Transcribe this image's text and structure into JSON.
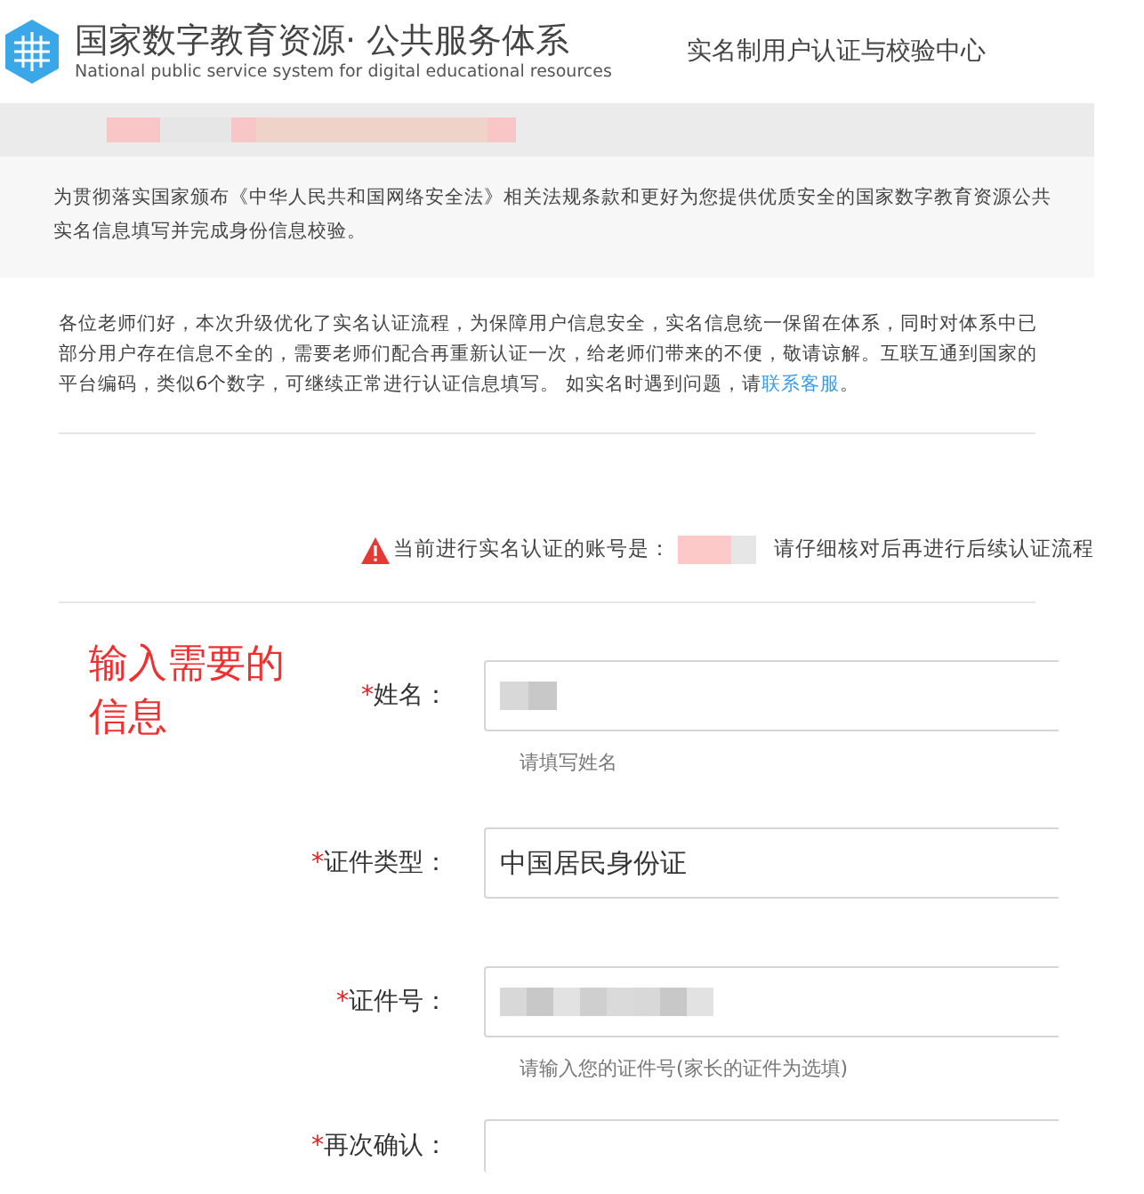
{
  "header": {
    "title": "国家数字教育资源· 公共服务体系",
    "subtitle": "National public service system for digital educational resources",
    "center_title": "实名制用户认证与校验中心"
  },
  "banner": {
    "redacted": true
  },
  "notice": {
    "lines": [
      "为贯彻落实国家颁布《中华人民共和国网络安全法》相关法规条款和更好为您提供优质安全的国家数字教育资源公共",
      "实名信息填写并完成身份信息校验。"
    ]
  },
  "intro": {
    "lines": [
      "各位老师们好，本次升级优化了实名认证流程，为保障用户信息安全，实名信息统一保留在体系，同时对体系中已",
      "部分用户存在信息不全的，需要老师们配合再重新认证一次，给老师们带来的不便，敬请谅解。互联互通到国家的"
    ],
    "last_line": "平台编码，类似6个数字，可继续正常进行认证信息填写。 如实名时遇到问题，请",
    "link": "联系客服",
    "end": "。"
  },
  "account": {
    "prefix": "当前进行实名认证的账号是：",
    "redacted": true,
    "suffix": "请仔细核对后再进行后续认证流程"
  },
  "annotation": "输入需要的信息",
  "fields": [
    {
      "kind": "text",
      "required_mark": "*",
      "label": "姓名：",
      "redacted": true,
      "hint": "请填写姓名"
    },
    {
      "kind": "select",
      "required_mark": "*",
      "label": "证件类型：",
      "value": "中国居民身份证"
    },
    {
      "kind": "text",
      "required_mark": "*",
      "label": "证件号：",
      "redacted": true,
      "hint": "请输入您的证件号(家长的证件为选填)"
    },
    {
      "kind": "text",
      "required_mark": "*",
      "label": "再次确认："
    }
  ]
}
